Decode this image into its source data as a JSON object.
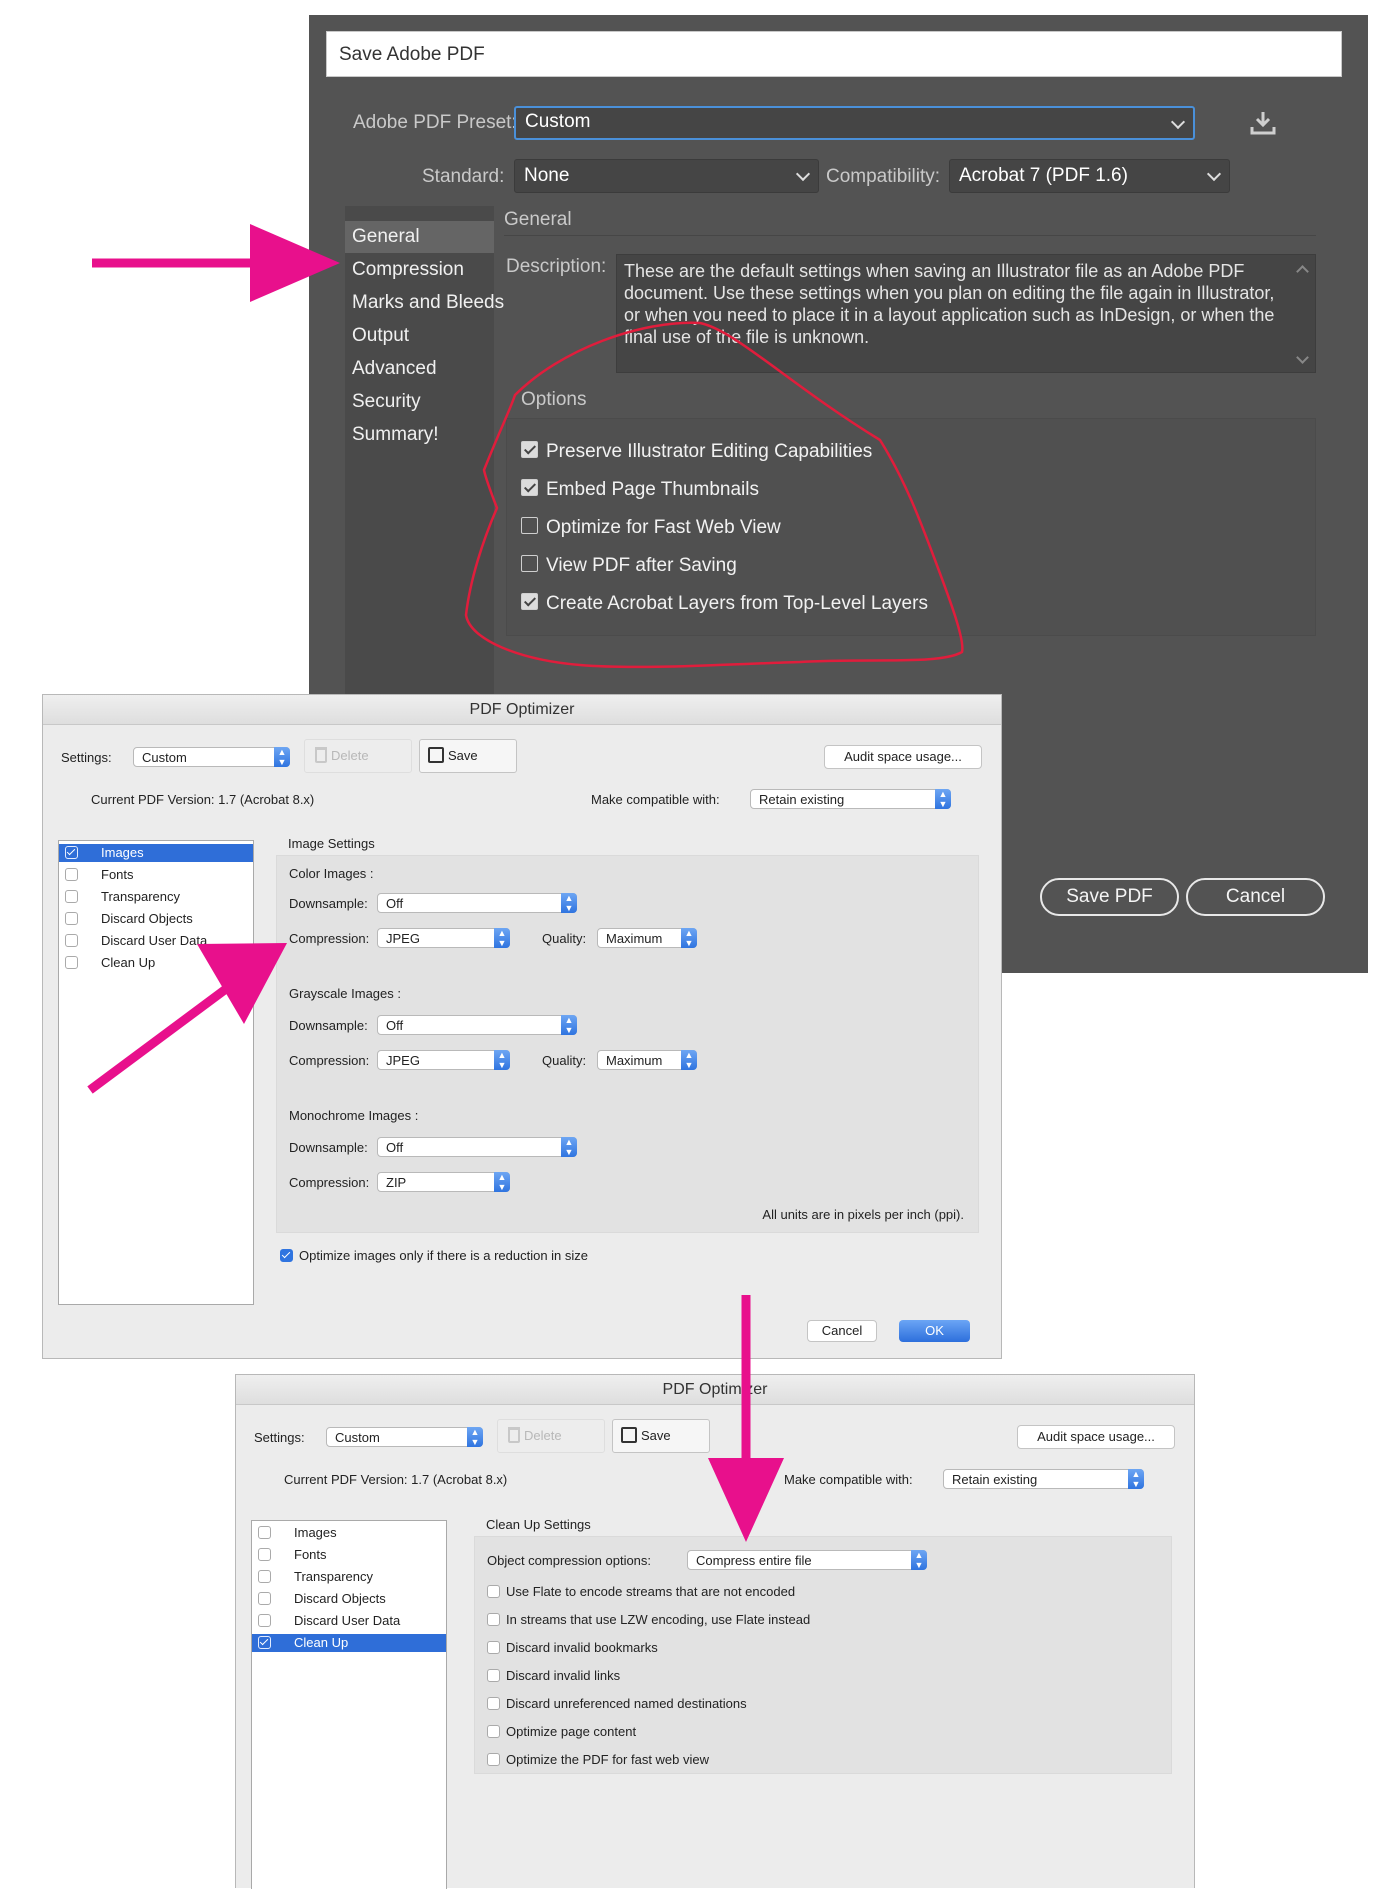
{
  "colors": {
    "annotation_arrow": "#e8108c",
    "annotation_circle": "#e01d3c",
    "ai_background": "#535353",
    "accent_blue": "#2f6ed8"
  },
  "illustrator": {
    "title": "Save Adobe PDF",
    "preset_label": "Adobe PDF Preset:",
    "preset_value": "Custom",
    "standard_label": "Standard:",
    "standard_value": "None",
    "compat_label": "Compatibility:",
    "compat_value": "Acrobat 7 (PDF 1.6)",
    "sidebar": [
      "General",
      "Compression",
      "Marks and Bleeds",
      "Output",
      "Advanced",
      "Security",
      "Summary!"
    ],
    "section_title": "General",
    "description_label": "Description:",
    "description": "These are the default settings when saving an Illustrator file as an Adobe PDF document. Use these settings when you plan on editing the file again in Illustrator, or when you need to place it in a layout application such as InDesign, or when the final use of the file is unknown.",
    "options_title": "Options",
    "options": [
      {
        "label": "Preserve Illustrator Editing Capabilities",
        "checked": true
      },
      {
        "label": "Embed Page Thumbnails",
        "checked": true
      },
      {
        "label": "Optimize for Fast Web View",
        "checked": false
      },
      {
        "label": "View PDF after Saving",
        "checked": false
      },
      {
        "label": "Create Acrobat Layers from Top-Level Layers",
        "checked": true
      }
    ],
    "save_button": "Save PDF",
    "cancel_button": "Cancel",
    "save_preset_icon": "download-icon"
  },
  "optimizer1": {
    "title": "PDF Optimizer",
    "settings_label": "Settings:",
    "settings_value": "Custom",
    "delete_label": "Delete",
    "save_label": "Save",
    "audit_label": "Audit space usage...",
    "version_text": "Current PDF Version: 1.7 (Acrobat 8.x)",
    "compat_label": "Make compatible with:",
    "compat_value": "Retain existing",
    "list": [
      {
        "label": "Images",
        "checked": true,
        "selected": true
      },
      {
        "label": "Fonts",
        "checked": false,
        "selected": false
      },
      {
        "label": "Transparency",
        "checked": false,
        "selected": false
      },
      {
        "label": "Discard Objects",
        "checked": false,
        "selected": false
      },
      {
        "label": "Discard User Data",
        "checked": false,
        "selected": false
      },
      {
        "label": "Clean Up",
        "checked": false,
        "selected": false
      }
    ],
    "section_title": "Image Settings",
    "color_title": "Color Images :",
    "gray_title": "Grayscale Images :",
    "mono_title": "Monochrome Images :",
    "downsample_label": "Downsample:",
    "compression_label": "Compression:",
    "quality_label": "Quality:",
    "color": {
      "downsample": "Off",
      "compression": "JPEG",
      "quality": "Maximum"
    },
    "gray": {
      "downsample": "Off",
      "compression": "JPEG",
      "quality": "Maximum"
    },
    "mono": {
      "downsample": "Off",
      "compression": "ZIP"
    },
    "units_note": "All units are in pixels per inch (ppi).",
    "optimize_only": "Optimize images only if there is a reduction in size",
    "cancel_label": "Cancel",
    "ok_label": "OK"
  },
  "optimizer2": {
    "title": "PDF Optimizer",
    "settings_label": "Settings:",
    "settings_value": "Custom",
    "delete_label": "Delete",
    "save_label": "Save",
    "audit_label": "Audit space usage...",
    "version_text": "Current PDF Version: 1.7 (Acrobat 8.x)",
    "compat_label": "Make compatible with:",
    "compat_value": "Retain existing",
    "list": [
      {
        "label": "Images",
        "checked": false,
        "selected": false
      },
      {
        "label": "Fonts",
        "checked": false,
        "selected": false
      },
      {
        "label": "Transparency",
        "checked": false,
        "selected": false
      },
      {
        "label": "Discard Objects",
        "checked": false,
        "selected": false
      },
      {
        "label": "Discard User Data",
        "checked": false,
        "selected": false
      },
      {
        "label": "Clean Up",
        "checked": true,
        "selected": true
      }
    ],
    "section_title": "Clean Up Settings",
    "object_compression_label": "Object compression options:",
    "object_compression_value": "Compress entire file",
    "cleanup_options": [
      "Use Flate to encode streams that are not encoded",
      "In streams that use LZW encoding, use Flate instead",
      "Discard invalid bookmarks",
      "Discard invalid links",
      "Discard unreferenced named destinations",
      "Optimize page content",
      "Optimize the PDF for fast web view"
    ]
  }
}
